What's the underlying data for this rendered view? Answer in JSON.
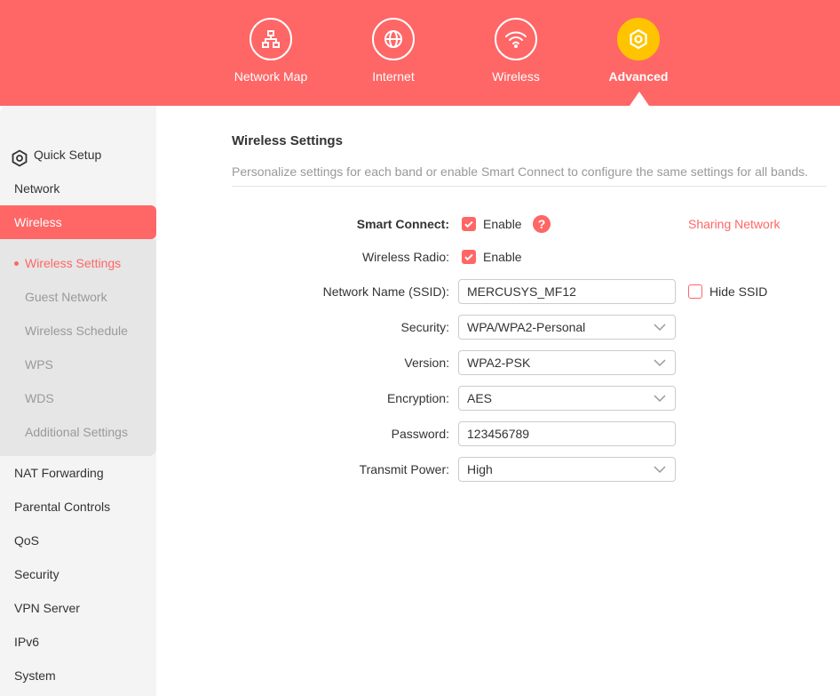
{
  "topnav": {
    "items": [
      {
        "label": "Network Map",
        "icon": "network-map-icon"
      },
      {
        "label": "Internet",
        "icon": "globe-icon"
      },
      {
        "label": "Wireless",
        "icon": "wifi-icon"
      },
      {
        "label": "Advanced",
        "icon": "gear-icon",
        "active": true
      }
    ]
  },
  "sidebar": {
    "quick_setup": "Quick Setup",
    "network": "Network",
    "wireless": "Wireless",
    "sub_items": [
      "Wireless Settings",
      "Guest Network",
      "Wireless Schedule",
      "WPS",
      "WDS",
      "Additional Settings"
    ],
    "more_items": [
      "NAT Forwarding",
      "Parental Controls",
      "QoS",
      "Security",
      "VPN Server",
      "IPv6",
      "System"
    ]
  },
  "main": {
    "title": "Wireless Settings",
    "description": "Personalize settings for each band or enable Smart Connect to configure the same settings for all bands.",
    "smart_connect_label": "Smart Connect:",
    "smart_connect_enable": "Enable",
    "help_glyph": "?",
    "sharing_network": "Sharing Network",
    "wireless_radio_label": "Wireless Radio:",
    "wireless_radio_enable": "Enable",
    "ssid_label": "Network Name (SSID):",
    "ssid_value": "MERCUSYS_MF12",
    "hide_ssid": "Hide SSID",
    "security_label": "Security:",
    "security_value": "WPA/WPA2-Personal",
    "version_label": "Version:",
    "version_value": "WPA2-PSK",
    "encryption_label": "Encryption:",
    "encryption_value": "AES",
    "password_label": "Password:",
    "password_value": "123456789",
    "transmit_label": "Transmit Power:",
    "transmit_value": "High"
  },
  "colors": {
    "accent": "#ff6666",
    "active_nav": "#ffc400"
  }
}
